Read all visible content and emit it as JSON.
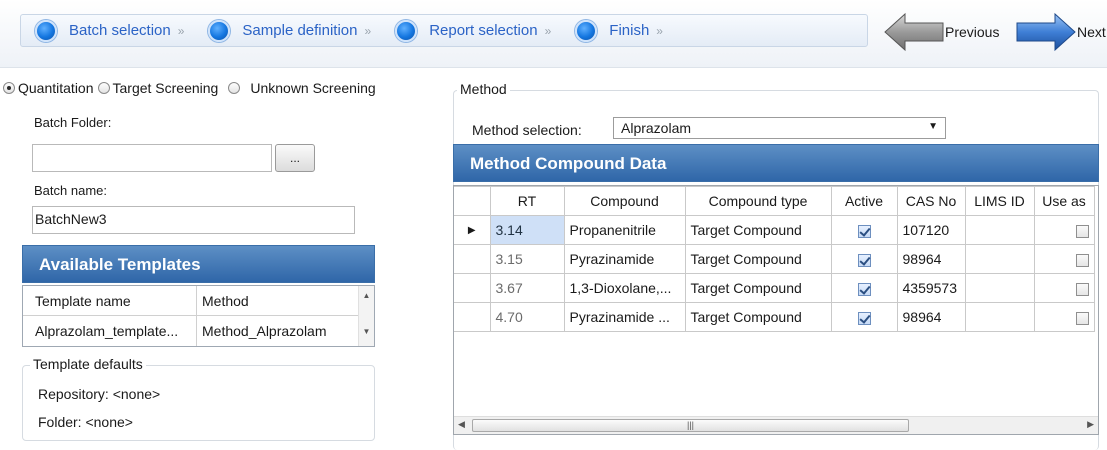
{
  "wizard": {
    "steps": [
      {
        "label": "Batch selection"
      },
      {
        "label": "Sample definition"
      },
      {
        "label": "Report selection"
      },
      {
        "label": "Finish"
      }
    ],
    "step_arrow": "»",
    "previous_label": "Previous",
    "next_label": "Next"
  },
  "screening_modes": [
    {
      "label": "Quantitation",
      "selected": true
    },
    {
      "label": "Target Screening",
      "selected": false
    },
    {
      "label": "Unknown Screening",
      "selected": false
    }
  ],
  "batch": {
    "folder_label": "Batch Folder:",
    "folder_value": "",
    "browse_label": "...",
    "name_label": "Batch name:",
    "name_value": "BatchNew3"
  },
  "templates": {
    "header": "Available Templates",
    "columns": [
      "Template name",
      "Method"
    ],
    "rows": [
      {
        "name": "Alprazolam_template...",
        "method": "Method_Alprazolam"
      }
    ]
  },
  "template_defaults": {
    "title": "Template defaults",
    "repository": "Repository: <none>",
    "folder": "Folder: <none>"
  },
  "method": {
    "group_title": "Method",
    "selection_label": "Method selection:",
    "selection_value": "Alprazolam",
    "compound_header": "Method Compound Data",
    "columns": [
      "RT",
      "Compound",
      "Compound type",
      "Active",
      "CAS No",
      "LIMS ID",
      "Use as"
    ],
    "rows": [
      {
        "rt": "3.14",
        "compound": "Propanenitrile",
        "type": "Target Compound",
        "active": true,
        "cas": "107120",
        "lims": "",
        "use_as": false,
        "current": true
      },
      {
        "rt": "3.15",
        "compound": "Pyrazinamide",
        "type": "Target Compound",
        "active": true,
        "cas": "98964",
        "lims": "",
        "use_as": false,
        "current": false
      },
      {
        "rt": "3.67",
        "compound": "1,3-Dioxolane,...",
        "type": "Target Compound",
        "active": true,
        "cas": "4359573",
        "lims": "",
        "use_as": false,
        "current": false
      },
      {
        "rt": "4.70",
        "compound": "Pyrazinamide ...",
        "type": "Target Compound",
        "active": true,
        "cas": "98964",
        "lims": "",
        "use_as": false,
        "current": false
      }
    ]
  },
  "colors": {
    "header_blue": "#2f66a8",
    "step_blue": "#1476e0",
    "step_text": "#2b63c6"
  },
  "icons": {
    "previous": "arrow-left-icon",
    "next": "arrow-right-icon",
    "row_pointer": "row-pointer-icon"
  }
}
